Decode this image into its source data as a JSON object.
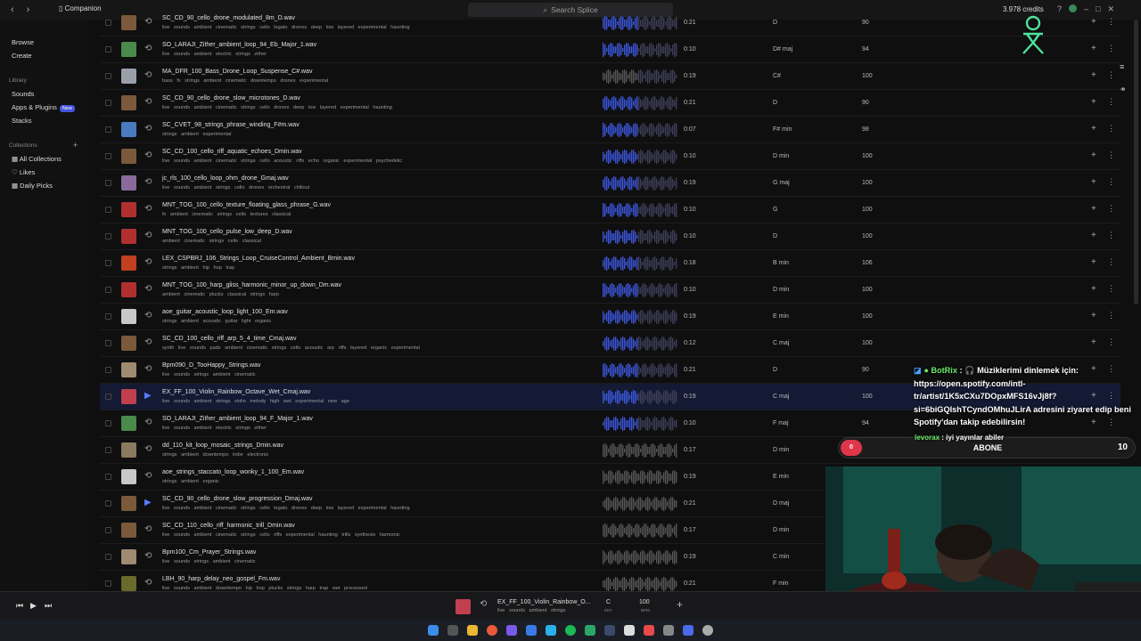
{
  "topbar": {
    "back": "‹",
    "forward": "›",
    "companion": "Companion",
    "search_placeholder": "Search Splice",
    "credits": "3.978 credits"
  },
  "sidebar": {
    "browse": "Browse",
    "create": "Create",
    "library_header": "Library",
    "sounds": "Sounds",
    "apps_plugins": "Apps & Plugins",
    "new_badge": "New",
    "stacks": "Stacks",
    "collections_header": "Collections",
    "collections_add": "+",
    "all_collections": "All Collections",
    "likes": "Likes",
    "daily_picks": "Daily Picks"
  },
  "rows": [
    {
      "name": "SC_CD_90_cello_drone_modulated_8m_D.wav",
      "tags": "live sounds ambient cinematic strings cello legato drones deep low layered experimental haunting",
      "dur": "0:21",
      "key": "D",
      "bpm": "90",
      "thumb": "#7a5a3a"
    },
    {
      "name": "SO_LARAJI_Zither_ambient_loop_94_Eb_Major_1.wav",
      "tags": "live sounds ambient electric strings zither",
      "dur": "0:10",
      "key": "D# maj",
      "bpm": "94",
      "thumb": "#4a8a4a"
    },
    {
      "name": "MA_DFR_100_Bass_Drone_Loop_Suspense_C#.wav",
      "tags": "bass fx strings ambient cinematic downtempo drones experimental",
      "dur": "0:19",
      "key": "C#",
      "bpm": "100",
      "thumb": "#9aa0a8"
    },
    {
      "name": "SC_CD_90_cello_drone_slow_microtones_D.wav",
      "tags": "live sounds ambient cinematic strings cello drones deep low layered experimental haunting",
      "dur": "0:21",
      "key": "D",
      "bpm": "90",
      "thumb": "#7a5a3a"
    },
    {
      "name": "SC_CVET_98_strings_phrase_winding_F#m.wav",
      "tags": "strings ambient experimental",
      "dur": "0:07",
      "key": "F# min",
      "bpm": "98",
      "thumb": "#4a7ac0"
    },
    {
      "name": "SC_CD_100_cello_riff_aquatic_echoes_Dmin.wav",
      "tags": "live sounds ambient cinematic strings cello acoustic riffs echo organic experimental psychedelic",
      "dur": "0:10",
      "key": "D min",
      "bpm": "100",
      "thumb": "#7a5a3a"
    },
    {
      "name": "jc_rls_100_cello_loop_ohm_drone_Gmaj.wav",
      "tags": "live sounds ambient strings cello drones orchestral chillout",
      "dur": "0:19",
      "key": "G maj",
      "bpm": "100",
      "thumb": "#8a6a9a"
    },
    {
      "name": "MNT_TOG_100_cello_texture_floating_glass_phrase_G.wav",
      "tags": "fx ambient cinematic strings cello textures classical",
      "dur": "0:10",
      "key": "G",
      "bpm": "100",
      "thumb": "#b03030"
    },
    {
      "name": "MNT_TOG_100_cello_pulse_low_deep_D.wav",
      "tags": "ambient cinematic strings cello classical",
      "dur": "0:10",
      "key": "D",
      "bpm": "100",
      "thumb": "#b03030"
    },
    {
      "name": "LEX_CSPBRJ_106_Strings_Loop_CruiseControl_Ambient_Bmin.wav",
      "tags": "strings ambient hip hop trap",
      "dur": "0:18",
      "key": "B min",
      "bpm": "106",
      "thumb": "#c04020"
    },
    {
      "name": "MNT_TOG_100_harp_gliss_harmonic_minor_up_down_Dm.wav",
      "tags": "ambient cinematic plucks classical strings harp",
      "dur": "0:10",
      "key": "D min",
      "bpm": "100",
      "thumb": "#b03030"
    },
    {
      "name": "aoe_guitar_acoustic_loop_light_100_Em.wav",
      "tags": "strings ambient acoustic guitar light organic",
      "dur": "0:19",
      "key": "E min",
      "bpm": "100",
      "thumb": "#c8c8c8"
    },
    {
      "name": "SC_CD_100_cello_riff_arp_5_4_time_Cmaj.wav",
      "tags": "synth live sounds pads ambient cinematic strings cello acoustic arp riffs layered organic experimental",
      "dur": "0:12",
      "key": "C maj",
      "bpm": "100",
      "thumb": "#7a5a3a"
    },
    {
      "name": "Bpm090_D_TooHappy_Strings.wav",
      "tags": "live sounds strings ambient cinematic",
      "dur": "0:21",
      "key": "D",
      "bpm": "90",
      "thumb": "#a08a70"
    },
    {
      "name": "EX_FF_100_Violin_Rainbow_Octave_Wet_Cmaj.wav",
      "tags": "live sounds ambient strings violin melody high wet experimental new age",
      "dur": "0:19",
      "key": "C maj",
      "bpm": "100",
      "thumb": "#c04050"
    },
    {
      "name": "SO_LARAJI_Zither_ambient_loop_94_F_Major_1.wav",
      "tags": "live sounds ambient electric strings zither",
      "dur": "0:10",
      "key": "F maj",
      "bpm": "94",
      "thumb": "#4a8a4a"
    },
    {
      "name": "dd_110_kit_loop_mosaic_strings_Dmin.wav",
      "tags": "strings ambient downtempo indie electronic",
      "dur": "0:17",
      "key": "D min",
      "bpm": "110",
      "thumb": "#8a7a60"
    },
    {
      "name": "aoe_strings_staccato_loop_wonky_1_100_Em.wav",
      "tags": "strings ambient organic",
      "dur": "0:19",
      "key": "E min",
      "bpm": "100",
      "thumb": "#c8c8c8"
    },
    {
      "name": "SC_CD_90_cello_drone_slow_progression_Dmaj.wav",
      "tags": "live sounds ambient cinematic strings cello legato drones deep low layered experimental haunting",
      "dur": "0:21",
      "key": "D maj",
      "bpm": "90",
      "thumb": "#7a5a3a"
    },
    {
      "name": "SC_CD_110_cello_riff_harmonic_trill_Dmin.wav",
      "tags": "live sounds ambient cinematic strings cello riffs experimental haunting trills synthesis harmonic",
      "dur": "0:17",
      "key": "D min",
      "bpm": "110",
      "thumb": "#7a5a3a"
    },
    {
      "name": "Bpm100_Cm_Prayer_Strings.wav",
      "tags": "live sounds strings ambient cinematic",
      "dur": "0:19",
      "key": "C min",
      "bpm": "100",
      "thumb": "#a08a70"
    },
    {
      "name": "LBH_90_harp_delay_neo_gospel_Fm.wav",
      "tags": "live sounds ambient downtempo hip hop plucks strings harp trap wet processed",
      "dur": "0:21",
      "key": "F min",
      "bpm": "90",
      "thumb": "#6a6a2a"
    }
  ],
  "player": {
    "name": "EX_FF_100_Violin_Rainbow_O...",
    "tags": "live sounds ambient strings",
    "key": "C",
    "key_label": "KEY",
    "bpm": "100",
    "bpm_label": "BPM",
    "add": "+"
  },
  "overlay": {
    "chat_user": "BotRix",
    "chat_text": ": 🎧 Müziklerimi dinlemek için: https://open.spotify.com/intl-tr/artist/1K5xCXu7DOpxMFS16vJj8f?si=6biGQIshTCyndOMhuJLirA adresini ziyaret edip beni Spotify'dan takip edebilirsin!",
    "chat2_user": "levorax",
    "chat2_text": ": iyi yayınlar abiler",
    "abone_label": "ABONE",
    "abone_left": "0",
    "abone_count": "10"
  }
}
